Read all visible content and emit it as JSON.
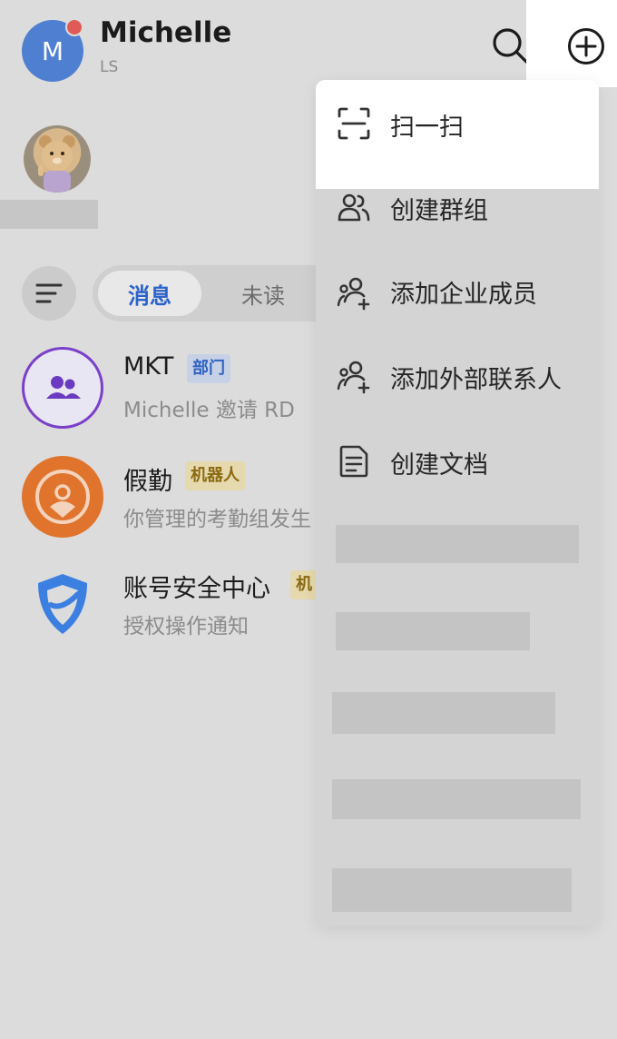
{
  "header": {
    "avatar_letter": "M",
    "user_name": "Michelle",
    "user_sub": "LS"
  },
  "tabs": {
    "active_label": "消息",
    "unread_label": "未读"
  },
  "chats": [
    {
      "title": "MKT",
      "tag": "部门",
      "subtitle": "Michelle 邀请   RD"
    },
    {
      "title": "假勤",
      "tag": "机器人",
      "subtitle": "你管理的考勤组发生"
    },
    {
      "title": "账号安全中心",
      "tag": "机",
      "subtitle": "授权操作通知"
    }
  ],
  "menu": {
    "items": [
      {
        "label": "扫一扫",
        "icon": "scan-icon"
      },
      {
        "label": "创建群组",
        "icon": "group-icon"
      },
      {
        "label": "添加企业成员",
        "icon": "add-member-icon"
      },
      {
        "label": "添加外部联系人",
        "icon": "add-contact-icon"
      },
      {
        "label": "创建文档",
        "icon": "document-icon"
      }
    ]
  },
  "colors": {
    "accent_blue": "#2b62c9",
    "badge_red": "#e05b55",
    "robot_orange": "#e0742d",
    "shield_blue": "#3b7fe0"
  }
}
